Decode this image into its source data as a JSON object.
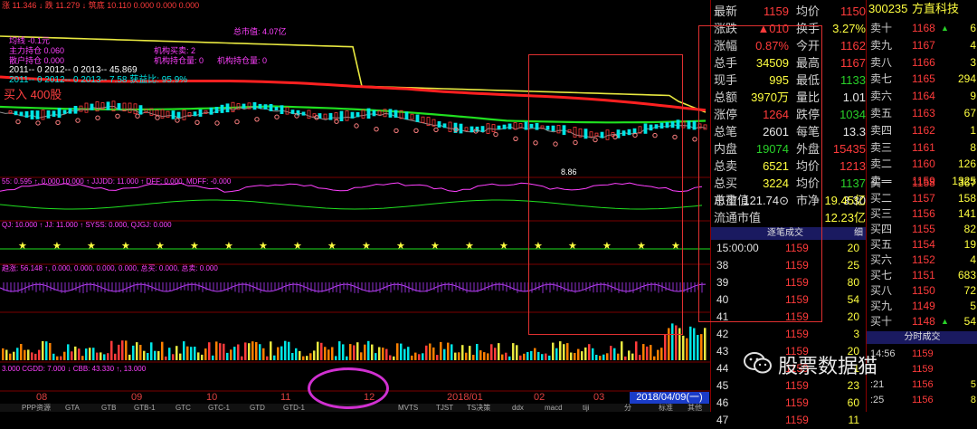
{
  "colors": {
    "up": "#ff3b3b",
    "down": "#29d129",
    "neutral": "#e8e8e8",
    "accent": "#ffff40",
    "highlight_box": "#e03030",
    "ellipse": "#d030d0"
  },
  "chart": {
    "header_line": "涨 11.346 ↓  跌 11.279 ↓  筑底 10.110  0.000  0.000  0.000",
    "indicator_texts": {
      "tl1": "均线 -0.1元",
      "tl2": "主力持仓 0.060",
      "tl3": "散户持仓 0.000",
      "tl4": "机构买卖: 2",
      "tl5": "机构持仓量: 0",
      "tl6": "机构持仓量: 0",
      "tl7": "总市值: 4.07亿",
      "year_row1": "2011-- 0    2012-- 0    2013-- 45.869",
      "year_row2": "2011-- 0    2012-- 0    2013-- 7.58    获益比: 95.9%",
      "buy_label": "买入 400股",
      "low_price": "8.86",
      "sub1": "55: 0.595 ↑, 0.000  10.000 ↑  JJJDD: 11.000 ↑  DFF: 0.000, MDFF: -0.000",
      "sub2": "QJ: 10.000 ↑  JJ: 11.000 ↑  SYSS: 0.000, QJGJ: 0.000",
      "sub3": "趋涨: 56.148 ↑, 0.000, 0.000, 0.000, 0.000, 总买: 0.000, 总卖: 0.000",
      "sub5": "3.000  CGDD: 7.000 ↓  CBB: 43.330 ↑, 13.000"
    },
    "date_axis": [
      "08",
      "09",
      "10",
      "11",
      "12",
      "2018/01",
      "02",
      "03"
    ],
    "date_badge": "2018/04/09(一)",
    "bottom_tabs": [
      "PPP资源",
      "GTA",
      "GTB",
      "GTB-1",
      "GTC",
      "GTC-1",
      "GTD",
      "GTD-1",
      "",
      "",
      "MVTS",
      "TJST",
      "TS决策",
      "ddx",
      "macd",
      "tiji",
      "分",
      "标准",
      "其他"
    ]
  },
  "quote": {
    "rows": [
      {
        "l1": "最新",
        "v1": "1159",
        "c1": "red",
        "l2": "均价",
        "v2": "1150",
        "c2": "red"
      },
      {
        "l1": "涨跌",
        "v1": "▲010",
        "c1": "red",
        "l2": "换手",
        "v2": "3.27%",
        "c2": "yellow"
      },
      {
        "l1": "涨幅",
        "v1": "0.87%",
        "c1": "red",
        "l2": "今开",
        "v2": "1162",
        "c2": "red"
      },
      {
        "l1": "总手",
        "v1": "34509",
        "c1": "yellow",
        "l2": "最高",
        "v2": "1167",
        "c2": "red"
      },
      {
        "l1": "现手",
        "v1": "995",
        "c1": "yellow",
        "l2": "最低",
        "v2": "1133",
        "c2": "green"
      },
      {
        "l1": "总额",
        "v1": "3970万",
        "c1": "yellow",
        "l2": "量比",
        "v2": "1.01",
        "c2": "white"
      },
      {
        "l1": "涨停",
        "v1": "1264",
        "c1": "red",
        "l2": "跌停",
        "v2": "1034",
        "c2": "green"
      },
      {
        "l1": "总笔",
        "v1": "2601",
        "c1": "white",
        "l2": "每笔",
        "v2": "13.3",
        "c2": "white"
      },
      {
        "l1": "内盘",
        "v1": "19074",
        "c1": "green",
        "l2": "外盘",
        "v2": "15435",
        "c2": "red"
      },
      {
        "l1": "总卖",
        "v1": "6521",
        "c1": "yellow",
        "l2": "均价",
        "v2": "1213",
        "c2": "red"
      },
      {
        "l1": "总买",
        "v1": "3224",
        "c1": "yellow",
        "l2": "均价",
        "v2": "1137",
        "c2": "green"
      },
      {
        "l1": "市盈",
        "v1": "121.74⊙",
        "c1": "white",
        "l2": "市净",
        "v2": "3.30",
        "c2": "white"
      }
    ],
    "mktcap_label": "总市值",
    "mktcap_value": "19.45亿",
    "float_label": "流通市值",
    "float_value": "12.23亿",
    "tab_label": "逐笔成交",
    "tab_right": "细",
    "trades": [
      {
        "t": "15:00:00",
        "p": "1159",
        "v": "20"
      },
      {
        "t": "38",
        "p": "1159",
        "v": "25"
      },
      {
        "t": "39",
        "p": "1159",
        "v": "80"
      },
      {
        "t": "40",
        "p": "1159",
        "v": "54"
      },
      {
        "t": "41",
        "p": "1159",
        "v": "20"
      },
      {
        "t": "42",
        "p": "1159",
        "v": "3"
      },
      {
        "t": "43",
        "p": "1159",
        "v": "20"
      },
      {
        "t": "44",
        "p": "1159",
        "v": "1"
      },
      {
        "t": "45",
        "p": "1159",
        "v": "23"
      },
      {
        "t": "46",
        "p": "1159",
        "v": "60"
      },
      {
        "t": "47",
        "p": "1159",
        "v": "11"
      }
    ]
  },
  "book": {
    "code": "300235",
    "name": "方直科技",
    "asks": [
      {
        "l": "卖十",
        "p": "1168",
        "v": "6",
        "arrow": "▲"
      },
      {
        "l": "卖九",
        "p": "1167",
        "v": "4"
      },
      {
        "l": "卖八",
        "p": "1166",
        "v": "3"
      },
      {
        "l": "卖七",
        "p": "1165",
        "v": "294"
      },
      {
        "l": "卖六",
        "p": "1164",
        "v": "9"
      },
      {
        "l": "卖五",
        "p": "1163",
        "v": "67"
      },
      {
        "l": "卖四",
        "p": "1162",
        "v": "1"
      },
      {
        "l": "卖三",
        "p": "1161",
        "v": "8"
      },
      {
        "l": "卖二",
        "p": "1160",
        "v": "126"
      },
      {
        "l": "卖一",
        "p": "1159",
        "v": "1325"
      }
    ],
    "bids": [
      {
        "l": "买一",
        "p": "1158",
        "v": "367"
      },
      {
        "l": "买二",
        "p": "1157",
        "v": "158"
      },
      {
        "l": "买三",
        "p": "1156",
        "v": "141"
      },
      {
        "l": "买四",
        "p": "1155",
        "v": "82"
      },
      {
        "l": "买五",
        "p": "1154",
        "v": "19"
      },
      {
        "l": "买六",
        "p": "1152",
        "v": "4"
      },
      {
        "l": "买七",
        "p": "1151",
        "v": "683"
      },
      {
        "l": "买八",
        "p": "1150",
        "v": "72"
      },
      {
        "l": "买九",
        "p": "1149",
        "v": "5"
      },
      {
        "l": "买十",
        "p": "1148",
        "v": "54",
        "arrow": "▲"
      }
    ],
    "tab_label": "分时成交",
    "trades": [
      {
        "t": "14:56",
        "p": "1159",
        "v": ""
      },
      {
        "t": "",
        "p": "1159",
        "v": ""
      },
      {
        "t": ":21",
        "p": "1156",
        "v": "5"
      },
      {
        "t": ":25",
        "p": "1156",
        "v": "8"
      }
    ]
  },
  "watermark": "股票数据猫"
}
